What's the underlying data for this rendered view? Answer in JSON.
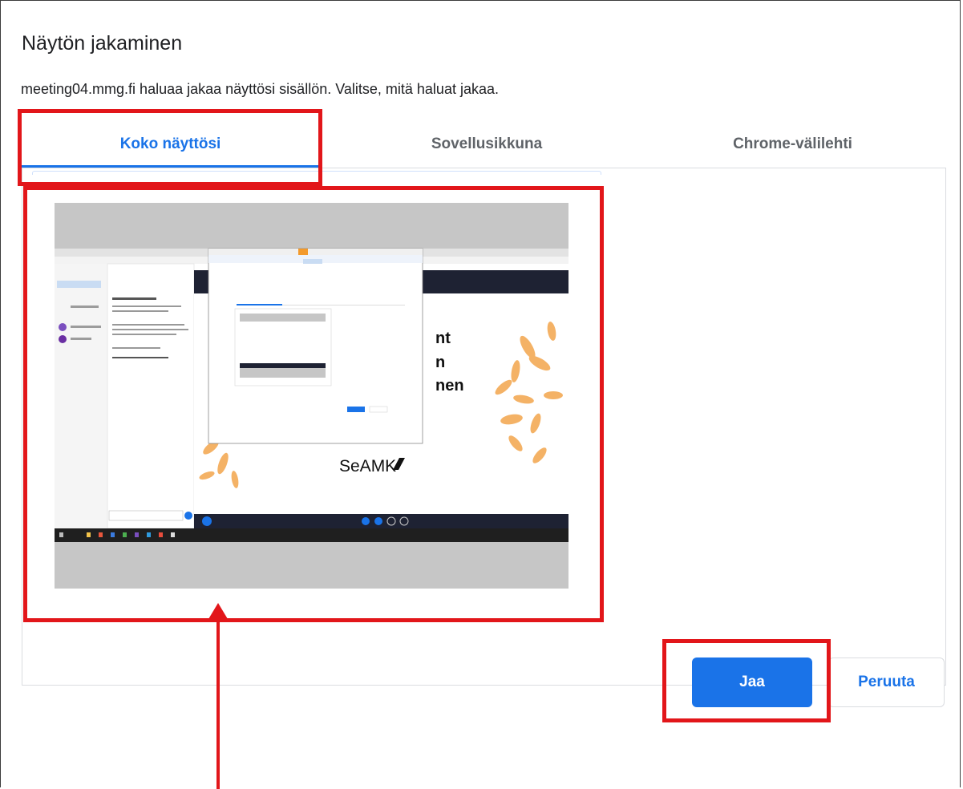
{
  "dialog": {
    "title": "Näytön jakaminen",
    "subtitle": "meeting04.mmg.fi haluaa jakaa näyttösi sisällön. Valitse, mitä haluat jakaa."
  },
  "tabs": [
    {
      "label": "Koko näyttösi",
      "active": true
    },
    {
      "label": "Sovellusikkuna",
      "active": false
    },
    {
      "label": "Chrome-välilehti",
      "active": false
    }
  ],
  "preview": {
    "brand_text": "SeAMK",
    "slide_text": [
      "nt",
      "n",
      "nen"
    ]
  },
  "buttons": {
    "share_label": "Jaa",
    "cancel_label": "Peruuta"
  },
  "colors": {
    "accent": "#1a73e8",
    "annotation": "#e2161a"
  }
}
